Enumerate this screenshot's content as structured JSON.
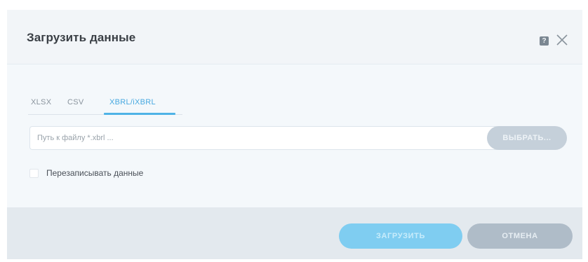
{
  "dialog": {
    "title": "Загрузить данные",
    "help_icon": "help-icon",
    "help_glyph": "?",
    "close_icon": "close-icon"
  },
  "tabs": [
    {
      "label": "XLSX",
      "active": false
    },
    {
      "label": "CSV",
      "active": false
    },
    {
      "label": "XBRL/iXBRL",
      "active": true
    }
  ],
  "file_input": {
    "value": "",
    "placeholder": "Путь к файлу *.xbrl ..."
  },
  "choose_button": {
    "label": "ВЫБРАТЬ..."
  },
  "overwrite_checkbox": {
    "label": "Перезаписывать данные",
    "checked": false
  },
  "footer": {
    "upload_label": "ЗАГРУЗИТЬ",
    "cancel_label": "ОТМЕНА"
  },
  "colors": {
    "accent": "#4fb3e6",
    "primary_button": "#7fcdf1",
    "secondary_button": "#afbcc8",
    "footer_bg": "#e3e9ee"
  }
}
